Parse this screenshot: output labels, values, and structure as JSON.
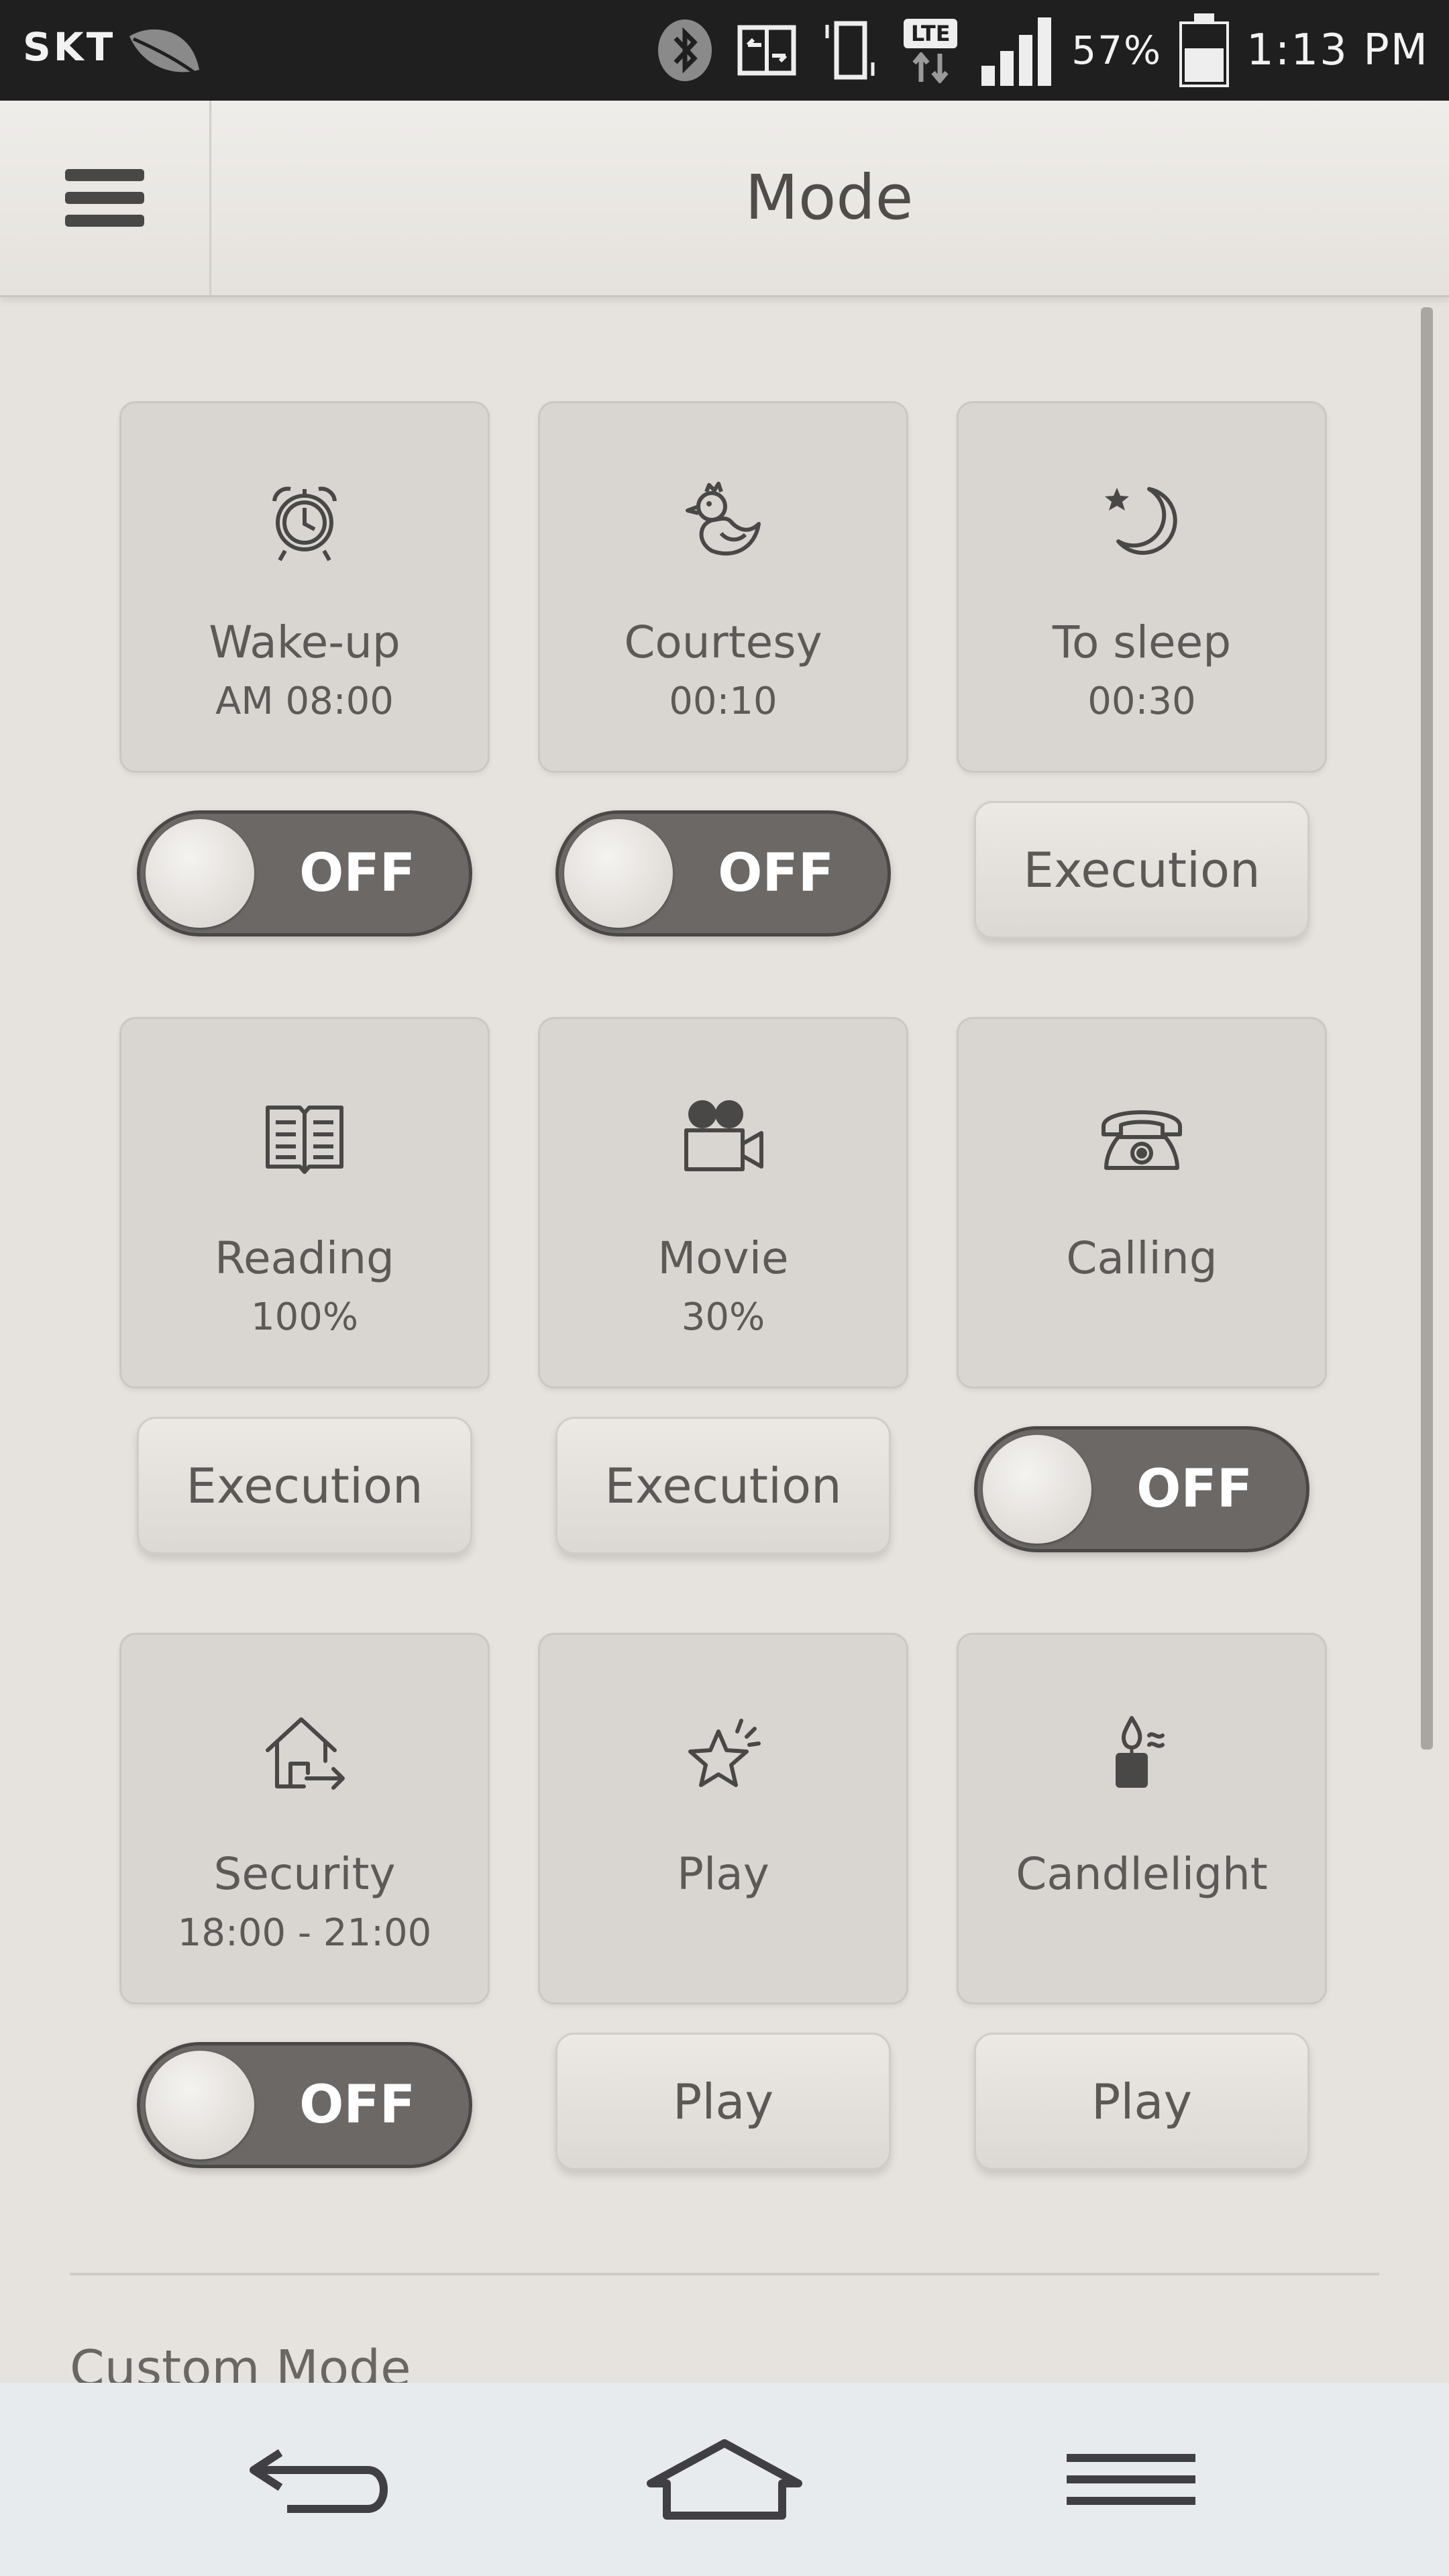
{
  "status_bar": {
    "carrier": "SKT",
    "lte_label": "LTE",
    "battery_percent": "57%",
    "time": "1:13 PM"
  },
  "header": {
    "title": "Mode"
  },
  "modes": [
    {
      "label": "Wake-up",
      "sub": "AM 08:00",
      "icon": "alarm-clock-icon",
      "control": {
        "type": "toggle",
        "text": "OFF"
      }
    },
    {
      "label": "Courtesy",
      "sub": "00:10",
      "icon": "duck-icon",
      "control": {
        "type": "toggle",
        "text": "OFF"
      }
    },
    {
      "label": "To sleep",
      "sub": "00:30",
      "icon": "moon-star-icon",
      "control": {
        "type": "button",
        "text": "Execution"
      }
    },
    {
      "label": "Reading",
      "sub": "100%",
      "icon": "book-icon",
      "control": {
        "type": "button",
        "text": "Execution"
      }
    },
    {
      "label": "Movie",
      "sub": "30%",
      "icon": "video-camera-icon",
      "control": {
        "type": "button",
        "text": "Execution"
      }
    },
    {
      "label": "Calling",
      "sub": "",
      "icon": "telephone-icon",
      "control": {
        "type": "toggle",
        "text": "OFF"
      }
    },
    {
      "label": "Security",
      "sub": "18:00 - 21:00",
      "icon": "house-exit-icon",
      "control": {
        "type": "toggle",
        "text": "OFF"
      }
    },
    {
      "label": "Play",
      "sub": "",
      "icon": "star-icon",
      "control": {
        "type": "button",
        "text": "Play"
      }
    },
    {
      "label": "Candlelight",
      "sub": "",
      "icon": "candle-icon",
      "control": {
        "type": "button",
        "text": "Play"
      }
    }
  ],
  "section": {
    "custom_mode_label": "Custom Mode"
  }
}
